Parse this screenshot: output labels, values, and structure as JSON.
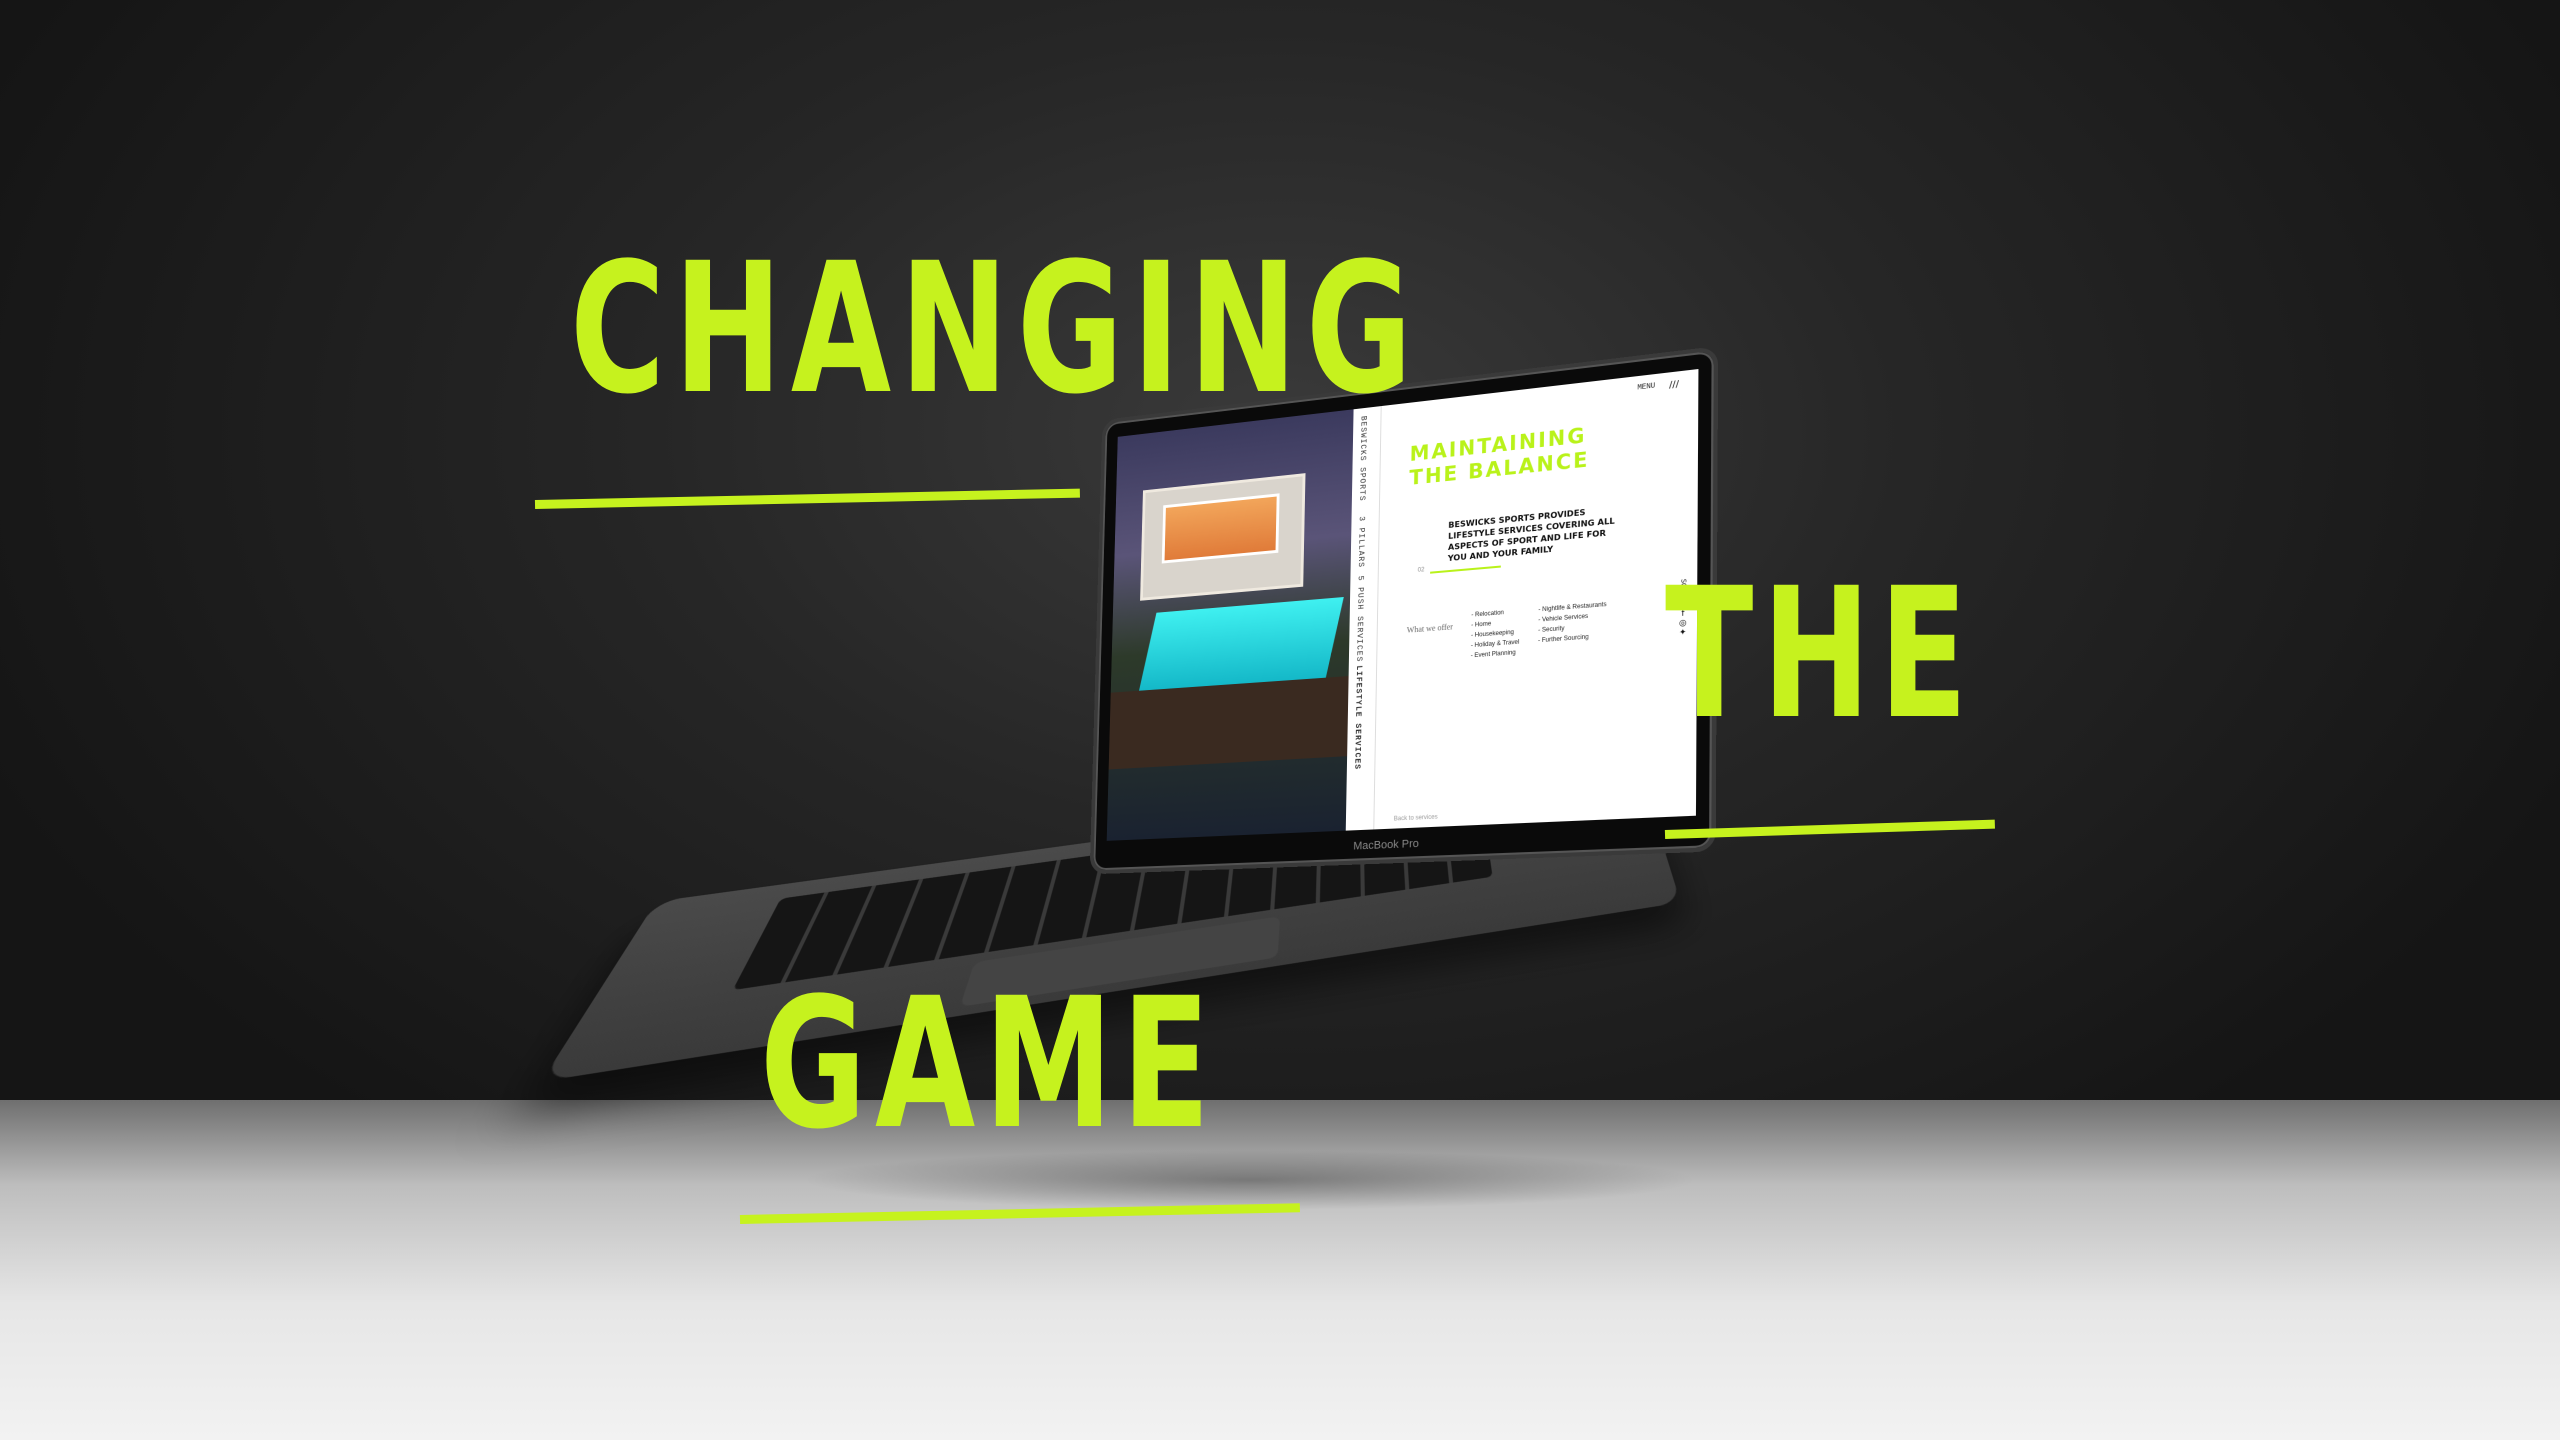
{
  "headline": {
    "line1": "CHANGING",
    "line2": "THE",
    "line3": "GAME"
  },
  "laptop": {
    "brand_label": "MacBook Pro",
    "screen": {
      "menu_label": "MENU",
      "menu_icon": "///",
      "sidebar_brand": "BESWICKS SPORTS",
      "sidebar_items": [
        "3 PILLARS",
        "5 PUSH SERVICES",
        "LIFESTYLE SERVICES"
      ],
      "heading_line1": "MAINTAINING",
      "heading_line2": "THE BALANCE",
      "sub_heading": "BESWICKS SPORTS PROVIDES LIFESTYLE SERVICES COVERING ALL ASPECTS OF SPORT AND LIFE FOR YOU AND YOUR FAMILY",
      "section_number": "02",
      "list_label": "What we offer",
      "list_col1": [
        "- Relocation",
        "- Home",
        "- Housekeeping",
        "- Holiday & Travel",
        "- Event Planning"
      ],
      "list_col2": [
        "- Nightlife & Restaurants",
        "- Vehicle Services",
        "- Security",
        "- Further Sourcing"
      ],
      "social_label": "SOCIAL",
      "back_link": "Back to services"
    }
  },
  "colors": {
    "accent": "#c6f21e",
    "background": "#1c1c1c",
    "floor": "#e6e6e6"
  }
}
